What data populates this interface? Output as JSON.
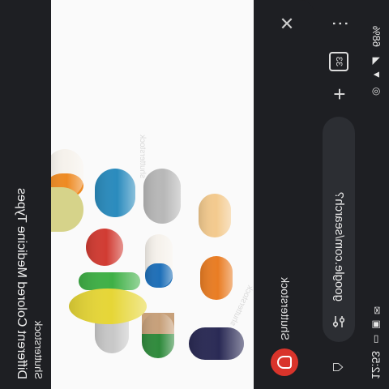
{
  "status_bar": {
    "time": "12:53",
    "notification_icons": [
      "cast-icon",
      "image-icon",
      "mail-icon"
    ],
    "signal_icons": [
      "hotspot-icon",
      "wifi-icon",
      "signal-icon"
    ],
    "battery": "68%"
  },
  "browser": {
    "url": "google.com/search?",
    "tabs_count": "33"
  },
  "lens": {
    "site_name": "Shutterstock",
    "result_title": "Different Colored Medicine Types"
  },
  "image": {
    "watermark": "shutterstock",
    "pill_colors": [
      "#7bc3c6",
      "#ee9cb8",
      "#d9d33a",
      "#e97d24",
      "#c4212a",
      "#3a8a3a",
      "#2a7bb8"
    ]
  }
}
